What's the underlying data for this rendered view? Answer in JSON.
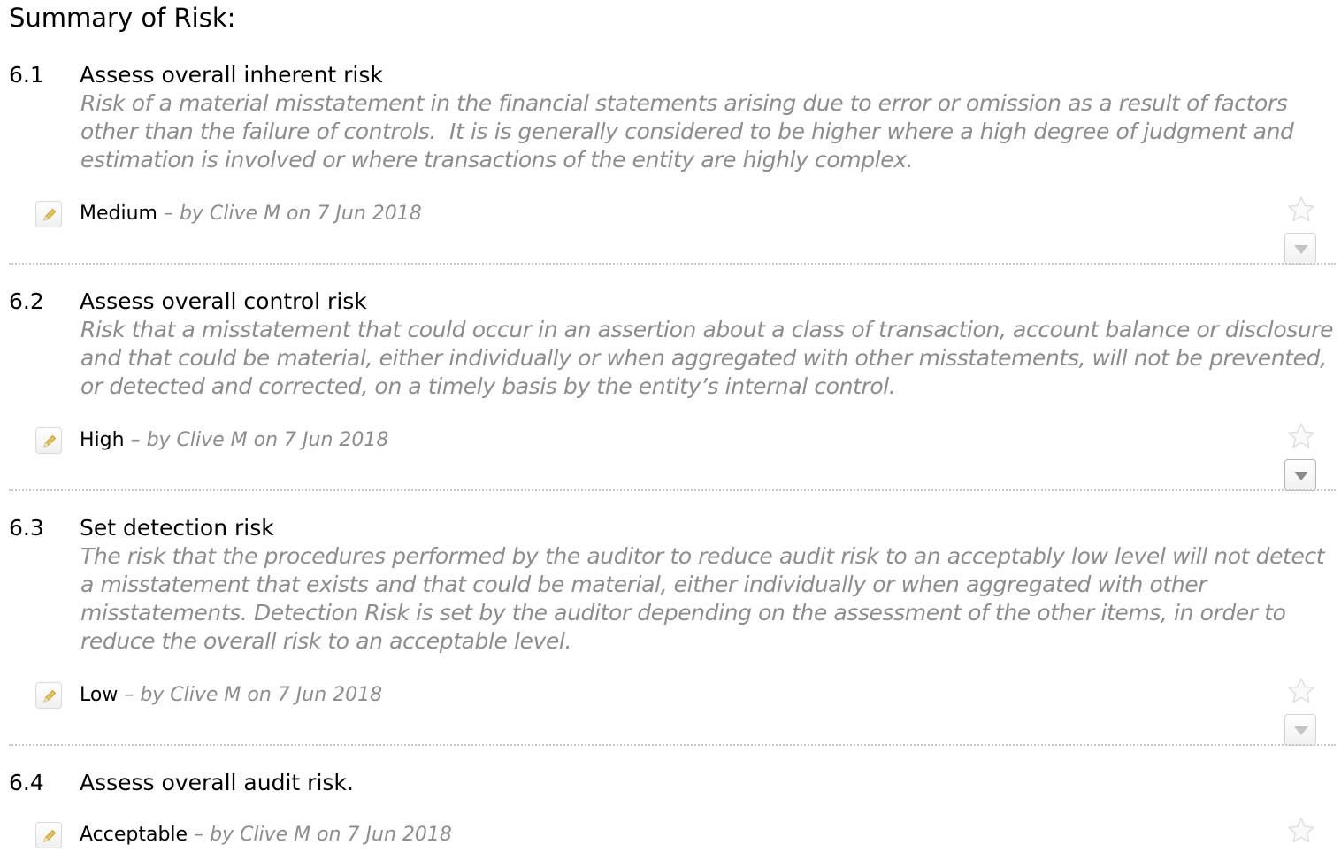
{
  "page": {
    "title": "Summary of Risk:"
  },
  "sections": [
    {
      "number": "6.1",
      "title": "Assess overall inherent risk",
      "description": "Risk of a material misstatement in the financial statements arising due to error or omission as a result of factors other than the failure of controls.  It is is generally considered to be higher where a high degree of judgment and estimation is involved or where transactions of the entity are highly complex.",
      "answer": "Medium",
      "meta": " – by Clive M on 7 Jun 2018"
    },
    {
      "number": "6.2",
      "title": "Assess overall control risk",
      "description": "Risk that a misstatement that could occur in an assertion about a class of transaction, account balance or disclosure and that could be material, either individually or when aggregated with other misstatements, will not be prevented, or detected and corrected, on a timely basis by the entity’s internal control.",
      "answer": "High",
      "meta": " – by Clive M on 7 Jun 2018"
    },
    {
      "number": "6.3",
      "title": "Set detection risk",
      "description": "The risk that the procedures performed by the auditor to reduce audit risk to an acceptably low level will not detect a misstatement that exists and that could be material, either individually or when aggregated with other misstatements. Detection Risk is set by the auditor depending on the assessment of the other items, in order to reduce the overall risk to an acceptable level.",
      "answer": "Low",
      "meta": " – by Clive M on 7 Jun 2018"
    },
    {
      "number": "6.4",
      "title": "Assess overall audit risk.",
      "description": "",
      "answer": "Acceptable",
      "meta": " – by Clive M on 7 Jun 2018"
    }
  ],
  "icons": {
    "edit": "pencil-icon",
    "favorite": "star-icon",
    "menu": "chevron-down-icon"
  },
  "colors": {
    "muted_text": "#8c8c8c",
    "divider": "#c8c8c8",
    "icon_border": "#d4d4d4",
    "pencil": "#e6c25a"
  }
}
